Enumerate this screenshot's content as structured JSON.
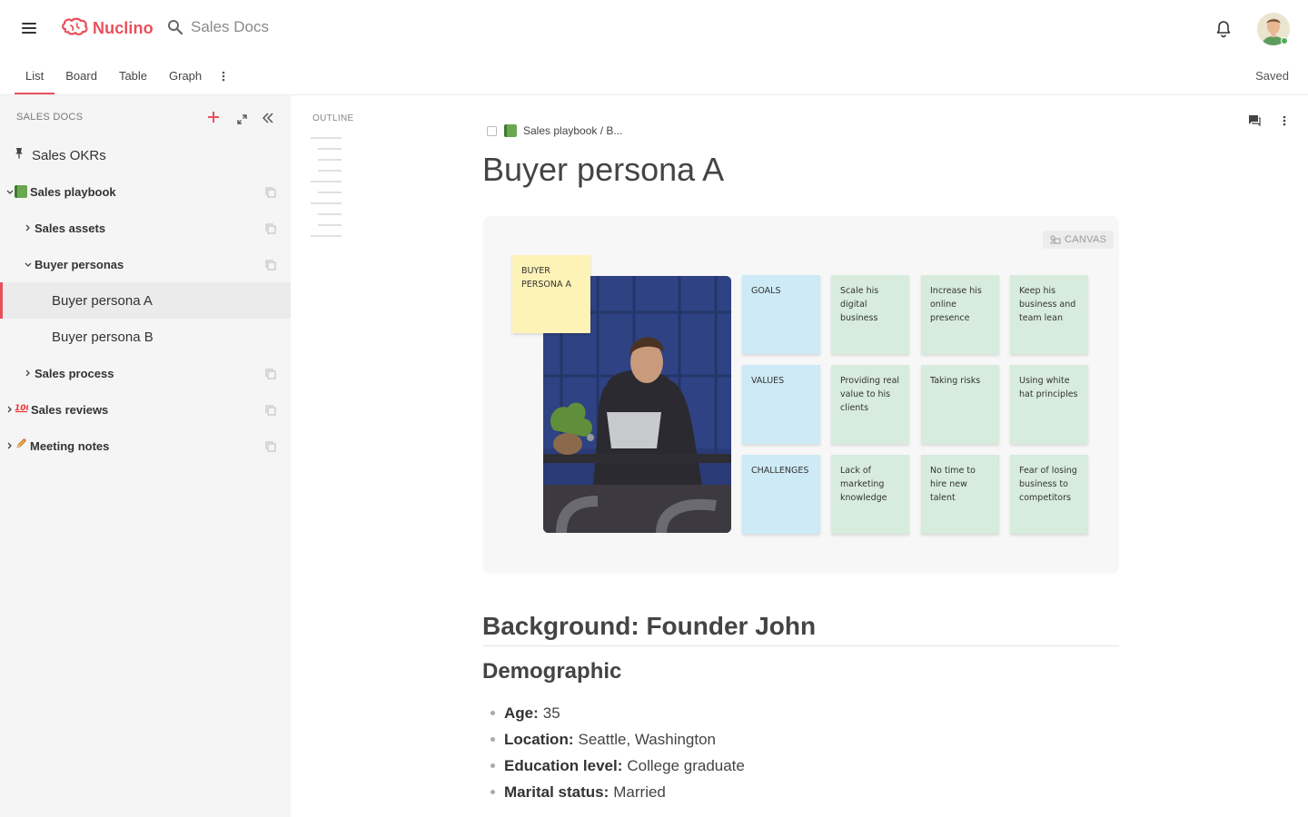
{
  "app": {
    "name": "Nuclino"
  },
  "search": {
    "label": "Sales Docs"
  },
  "tabs": [
    {
      "label": "List",
      "active": true
    },
    {
      "label": "Board"
    },
    {
      "label": "Table"
    },
    {
      "label": "Graph"
    }
  ],
  "status": {
    "saved": "Saved"
  },
  "sidebar": {
    "header": "SALES DOCS",
    "items": [
      {
        "label": "Sales OKRs"
      },
      {
        "label": "Sales playbook"
      },
      {
        "label": "Sales assets"
      },
      {
        "label": "Buyer personas"
      },
      {
        "label": "Buyer persona A",
        "selected": true
      },
      {
        "label": "Buyer persona B"
      },
      {
        "label": "Sales process"
      },
      {
        "label": "Sales reviews"
      },
      {
        "label": "Meeting notes"
      }
    ]
  },
  "outline": {
    "title": "OUTLINE"
  },
  "doc": {
    "breadcrumb": "Sales playbook / B...",
    "title": "Buyer persona A",
    "canvas": {
      "badge": "CANVAS",
      "persona_note": "BUYER PERSONA A",
      "rows": [
        {
          "label": "GOALS",
          "notes": [
            "Scale his digital business",
            "Increase his online presence",
            "Keep his business and team lean"
          ]
        },
        {
          "label": "VALUES",
          "notes": [
            "Providing real value to his clients",
            "Taking risks",
            "Using white hat principles"
          ]
        },
        {
          "label": "CHALLENGES",
          "notes": [
            "Lack of marketing knowledge",
            "No time to hire new talent",
            "Fear of losing business to competitors"
          ]
        }
      ]
    },
    "heading_background": "Background: Founder John",
    "heading_demographic": "Demographic",
    "demographics": [
      {
        "key": "Age:",
        "value": "35"
      },
      {
        "key": "Location:",
        "value": "Seattle, Washington"
      },
      {
        "key": "Education level:",
        "value": "College graduate"
      },
      {
        "key": "Marital status:",
        "value": "Married"
      }
    ]
  },
  "colors": {
    "accent": "#e8505b",
    "sticky_yellow": "#fdf3b7",
    "sticky_blue": "#cdeaf6",
    "sticky_green": "#d7ecdc"
  }
}
